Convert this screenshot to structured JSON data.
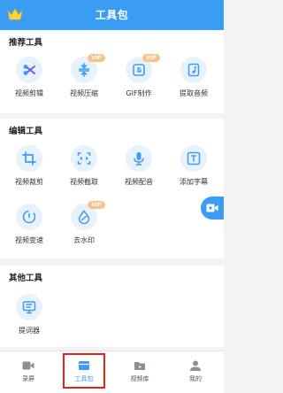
{
  "header": {
    "title": "工具包"
  },
  "vip_label": "VIP",
  "recommended": {
    "title": "推荐工具",
    "tools": [
      {
        "label": "视频剪辑",
        "icon": "scissors-icon"
      },
      {
        "label": "视频压缩",
        "icon": "compress-icon",
        "vip": true
      },
      {
        "label": "GIF制作",
        "icon": "gif-icon",
        "vip": true
      },
      {
        "label": "提取音频",
        "icon": "music-file-icon"
      }
    ]
  },
  "editing": {
    "title": "编辑工具",
    "tools": [
      {
        "label": "视频裁剪",
        "icon": "crop-icon"
      },
      {
        "label": "视频截取",
        "icon": "trim-icon"
      },
      {
        "label": "视频配音",
        "icon": "microphone-icon"
      },
      {
        "label": "添加字幕",
        "icon": "subtitle-icon"
      },
      {
        "label": "视频变速",
        "icon": "speed-icon"
      },
      {
        "label": "去水印",
        "icon": "watermark-remove-icon",
        "vip": true
      }
    ]
  },
  "other": {
    "title": "其他工具",
    "tools": [
      {
        "label": "提词器",
        "icon": "teleprompter-icon"
      }
    ]
  },
  "tabbar": {
    "items": [
      {
        "label": "录屏",
        "icon": "record-icon"
      },
      {
        "label": "工具包",
        "icon": "toolbox-icon",
        "active": true
      },
      {
        "label": "视频库",
        "icon": "video-library-icon"
      },
      {
        "label": "我的",
        "icon": "profile-icon"
      }
    ]
  },
  "colors": {
    "accent": "#3b9cf3",
    "icon_bg": "#e8f2fd",
    "vip_badge": "#f8c28a",
    "highlight_box": "#e0221b"
  }
}
